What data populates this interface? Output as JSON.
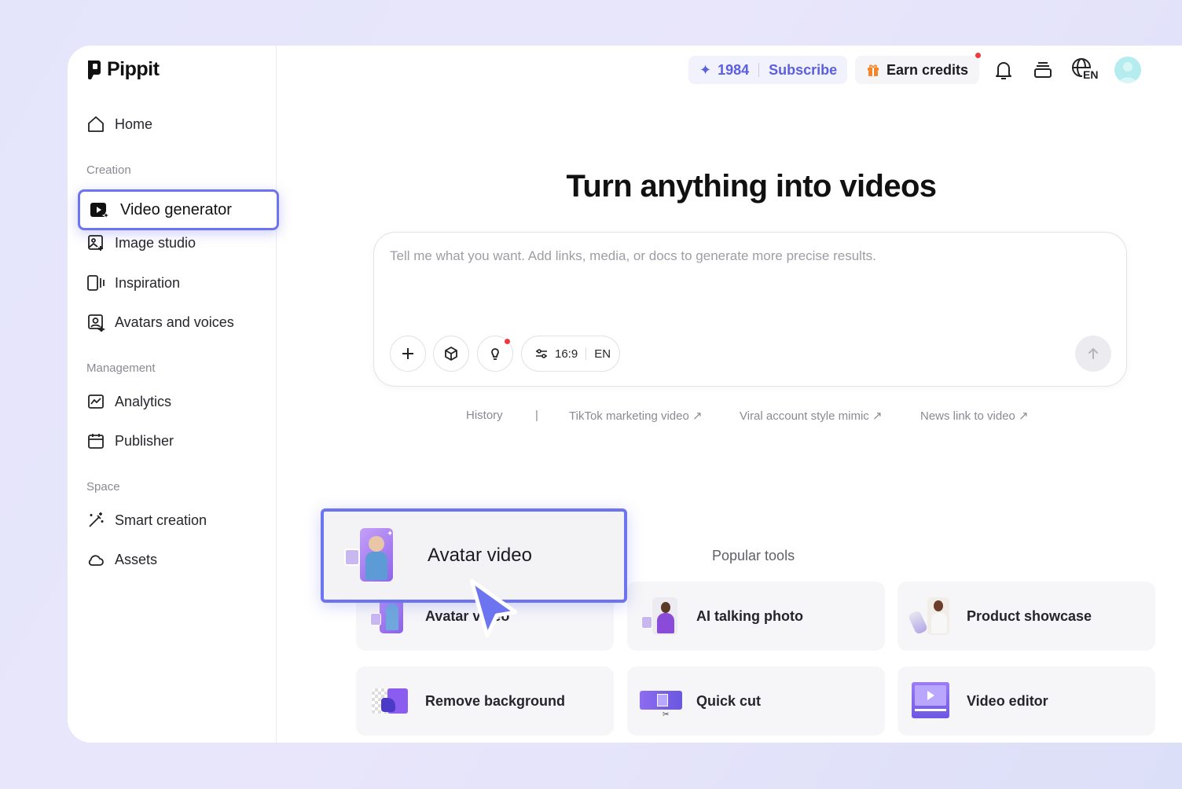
{
  "brand": {
    "name": "Pippit"
  },
  "sidebar": {
    "home": "Home",
    "sections": {
      "creation": "Creation",
      "management": "Management",
      "space": "Space"
    },
    "items": [
      {
        "label": "Video generator",
        "icon": "video-generator-icon",
        "active": true
      },
      {
        "label": "Image studio",
        "icon": "image-studio-icon"
      },
      {
        "label": "Inspiration",
        "icon": "inspiration-icon"
      },
      {
        "label": "Avatars and voices",
        "icon": "avatar-voice-icon"
      },
      {
        "label": "Analytics",
        "icon": "analytics-icon"
      },
      {
        "label": "Publisher",
        "icon": "calendar-icon"
      },
      {
        "label": "Smart creation",
        "icon": "magic-wand-icon"
      },
      {
        "label": "Assets",
        "icon": "cloud-icon"
      }
    ]
  },
  "topbar": {
    "credits": "1984",
    "subscribe": "Subscribe",
    "earn_credits": "Earn credits",
    "language_badge": "EN"
  },
  "main": {
    "title": "Turn anything into videos",
    "prompt_placeholder": "Tell me what you want. Add links, media, or docs to generate more precise results.",
    "aspect_ratio": "16:9",
    "language": "EN",
    "suggestions": {
      "history": "History",
      "separator": "|",
      "items": [
        "TikTok marketing video ↗",
        "Viral account style mimic ↗",
        "News link to video ↗"
      ]
    },
    "popular_tools_label": "Popular tools",
    "highlight_label": "Avatar video",
    "tools": [
      {
        "label": "Avatar video"
      },
      {
        "label": "AI talking photo"
      },
      {
        "label": "Product showcase"
      },
      {
        "label": "Remove background"
      },
      {
        "label": "Quick cut"
      },
      {
        "label": "Video editor"
      }
    ]
  },
  "colors": {
    "accent": "#5a5fe0",
    "highlight_border": "#6d74f0",
    "notification_dot": "#ef3b3b",
    "gift_orange": "#f5862b"
  }
}
